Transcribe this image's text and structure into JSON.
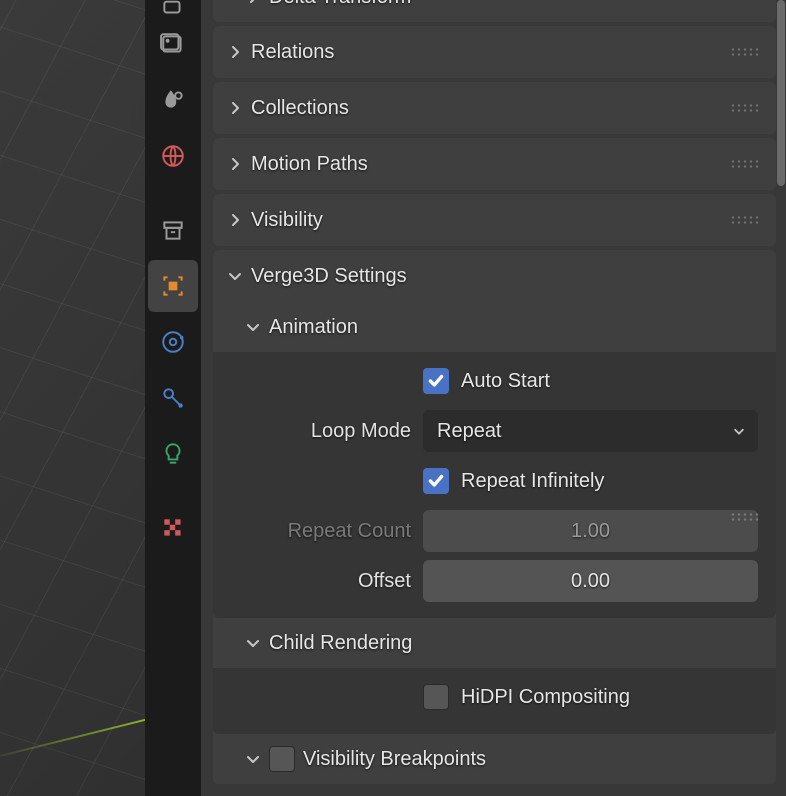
{
  "tabs": [
    {
      "name": "render-tab",
      "icon": "render"
    },
    {
      "name": "output-tab",
      "icon": "output"
    },
    {
      "name": "scene-tab",
      "icon": "scene"
    },
    {
      "name": "world-tab",
      "icon": "world",
      "tint": "red"
    },
    {
      "name": "spacer"
    },
    {
      "name": "object-data-tab",
      "icon": "objectdata"
    },
    {
      "name": "object-tab",
      "icon": "object",
      "active": true
    },
    {
      "name": "physics-tab",
      "icon": "physics",
      "tint": "blue"
    },
    {
      "name": "constraints-tab",
      "icon": "constraints",
      "tint": "blue"
    },
    {
      "name": "data-tab",
      "icon": "lamp",
      "tint": "green"
    },
    {
      "name": "spacer"
    },
    {
      "name": "texture-tab",
      "icon": "texture",
      "tint": "red"
    }
  ],
  "panels": {
    "delta_transform": {
      "title": "Delta Transform",
      "expanded": false
    },
    "relations": {
      "title": "Relations",
      "expanded": false
    },
    "collections": {
      "title": "Collections",
      "expanded": false
    },
    "motion_paths": {
      "title": "Motion Paths",
      "expanded": false
    },
    "visibility": {
      "title": "Visibility",
      "expanded": false
    },
    "verge3d": {
      "title": "Verge3D Settings",
      "expanded": true,
      "animation": {
        "title": "Animation",
        "expanded": true,
        "auto_start": {
          "label": "Auto Start",
          "checked": true
        },
        "loop_mode": {
          "label": "Loop Mode",
          "value": "Repeat"
        },
        "repeat_infinitely": {
          "label": "Repeat Infinitely",
          "checked": true
        },
        "repeat_count": {
          "label": "Repeat Count",
          "value": "1.00"
        },
        "offset": {
          "label": "Offset",
          "value": "0.00"
        }
      },
      "child_rendering": {
        "title": "Child Rendering",
        "expanded": true,
        "hidpi": {
          "label": "HiDPI Compositing",
          "checked": false
        }
      },
      "visibility_breakpoints": {
        "title": "Visibility Breakpoints",
        "expanded": true,
        "enabled": false
      }
    }
  }
}
